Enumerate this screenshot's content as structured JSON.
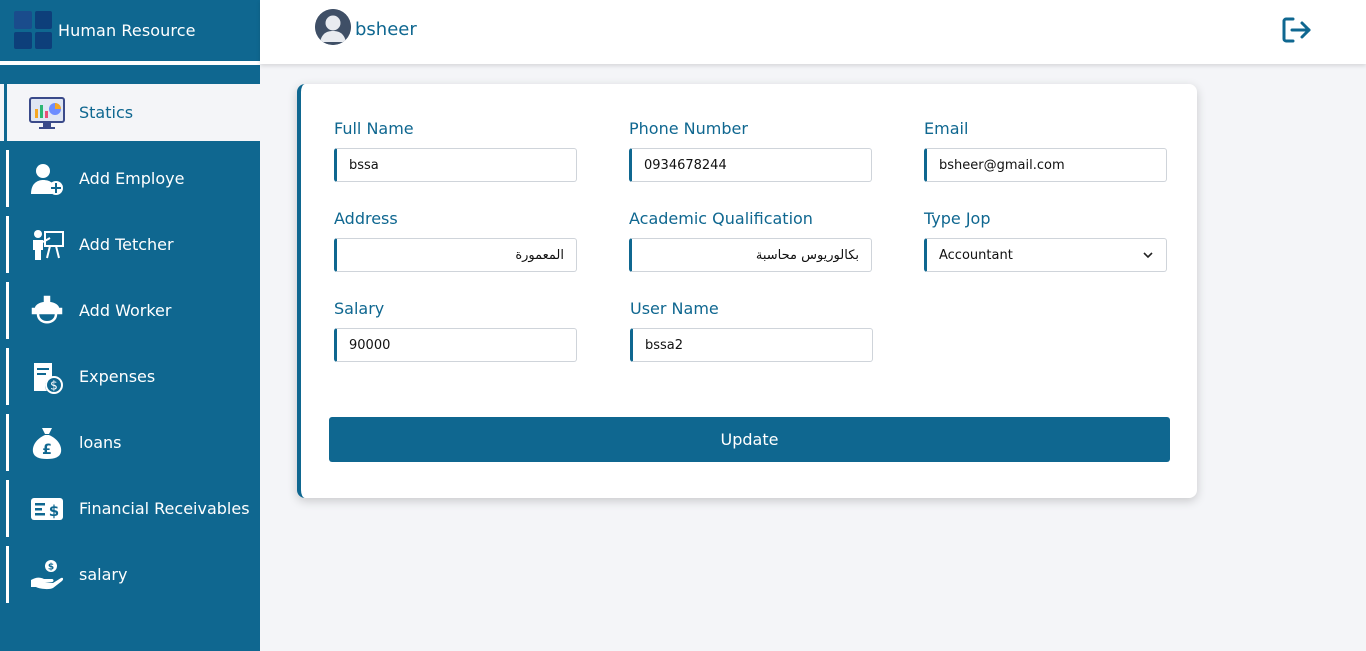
{
  "app": {
    "title": "Human Resource"
  },
  "user": {
    "name": "bsheer"
  },
  "sidebar": {
    "items": [
      {
        "label": "Statics",
        "icon": "statistics-monitor-icon",
        "active": true
      },
      {
        "label": "Add Employe",
        "icon": "add-user-icon"
      },
      {
        "label": "Add Tetcher",
        "icon": "teacher-icon"
      },
      {
        "label": "Add Worker",
        "icon": "worker-helmet-icon"
      },
      {
        "label": "Expenses",
        "icon": "expenses-icon"
      },
      {
        "label": "loans",
        "icon": "money-bag-icon"
      },
      {
        "label": "Financial Receivables",
        "icon": "receivables-icon"
      },
      {
        "label": "salary",
        "icon": "salary-hand-icon"
      }
    ]
  },
  "form": {
    "full_name": {
      "label": "Full Name",
      "value": "bssa"
    },
    "phone": {
      "label": "Phone Number",
      "value": "0934678244"
    },
    "email": {
      "label": "Email",
      "value": "bsheer@gmail.com"
    },
    "address": {
      "label": "Address",
      "value": "المعمورة"
    },
    "qualification": {
      "label": "Academic Qualification",
      "value": "بكالوريوس محاسبة"
    },
    "job_type": {
      "label": "Type Jop",
      "value": "Accountant"
    },
    "salary": {
      "label": "Salary",
      "value": "90000"
    },
    "username": {
      "label": "User Name",
      "value": "bssa2"
    },
    "submit_label": "Update"
  },
  "colors": {
    "primary": "#0f6790",
    "background": "#f4f5f8"
  }
}
